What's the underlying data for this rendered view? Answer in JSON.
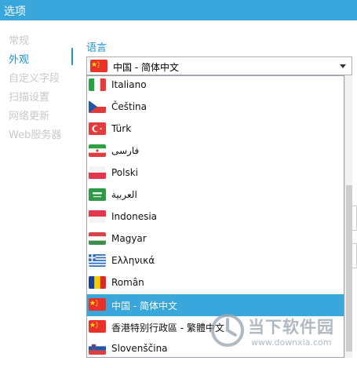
{
  "window": {
    "title": "选项"
  },
  "sidebar": {
    "items": [
      {
        "label": "常规"
      },
      {
        "label": "外观"
      },
      {
        "label": "自定义字段"
      },
      {
        "label": "扫描设置"
      },
      {
        "label": "网络更新"
      },
      {
        "label": "Web服务器"
      }
    ]
  },
  "language": {
    "section_label": "语言",
    "selected": "中国 - 简体中文",
    "options": [
      {
        "label": "Italiano",
        "flag": "flag-italy"
      },
      {
        "label": "Čeština",
        "flag": "flag-czech"
      },
      {
        "label": "Türk",
        "flag": "flag-turkey"
      },
      {
        "label": "فارسی",
        "flag": "flag-iran"
      },
      {
        "label": "Polski",
        "flag": "flag-poland"
      },
      {
        "label": "العربية",
        "flag": "flag-saudi-arabia"
      },
      {
        "label": "Indonesia",
        "flag": "flag-indonesia"
      },
      {
        "label": "Magyar",
        "flag": "flag-hungary"
      },
      {
        "label": "Ελληνικά",
        "flag": "flag-greece"
      },
      {
        "label": "Român",
        "flag": "flag-romania"
      },
      {
        "label": "中国 - 简体中文",
        "flag": "flag-china",
        "selected": true
      },
      {
        "label": "香港特别行政區 - 繁體中文",
        "flag": "flag-hong-kong"
      },
      {
        "label": "Slovenščina",
        "flag": "flag-slovenia"
      }
    ]
  },
  "watermark": {
    "brand": "当下软件园",
    "url": "www.downxia.com"
  },
  "colors": {
    "accent": "#3aa7dc",
    "nav_active": "#1d93d1",
    "nav_inactive": "#c8c8c8"
  }
}
